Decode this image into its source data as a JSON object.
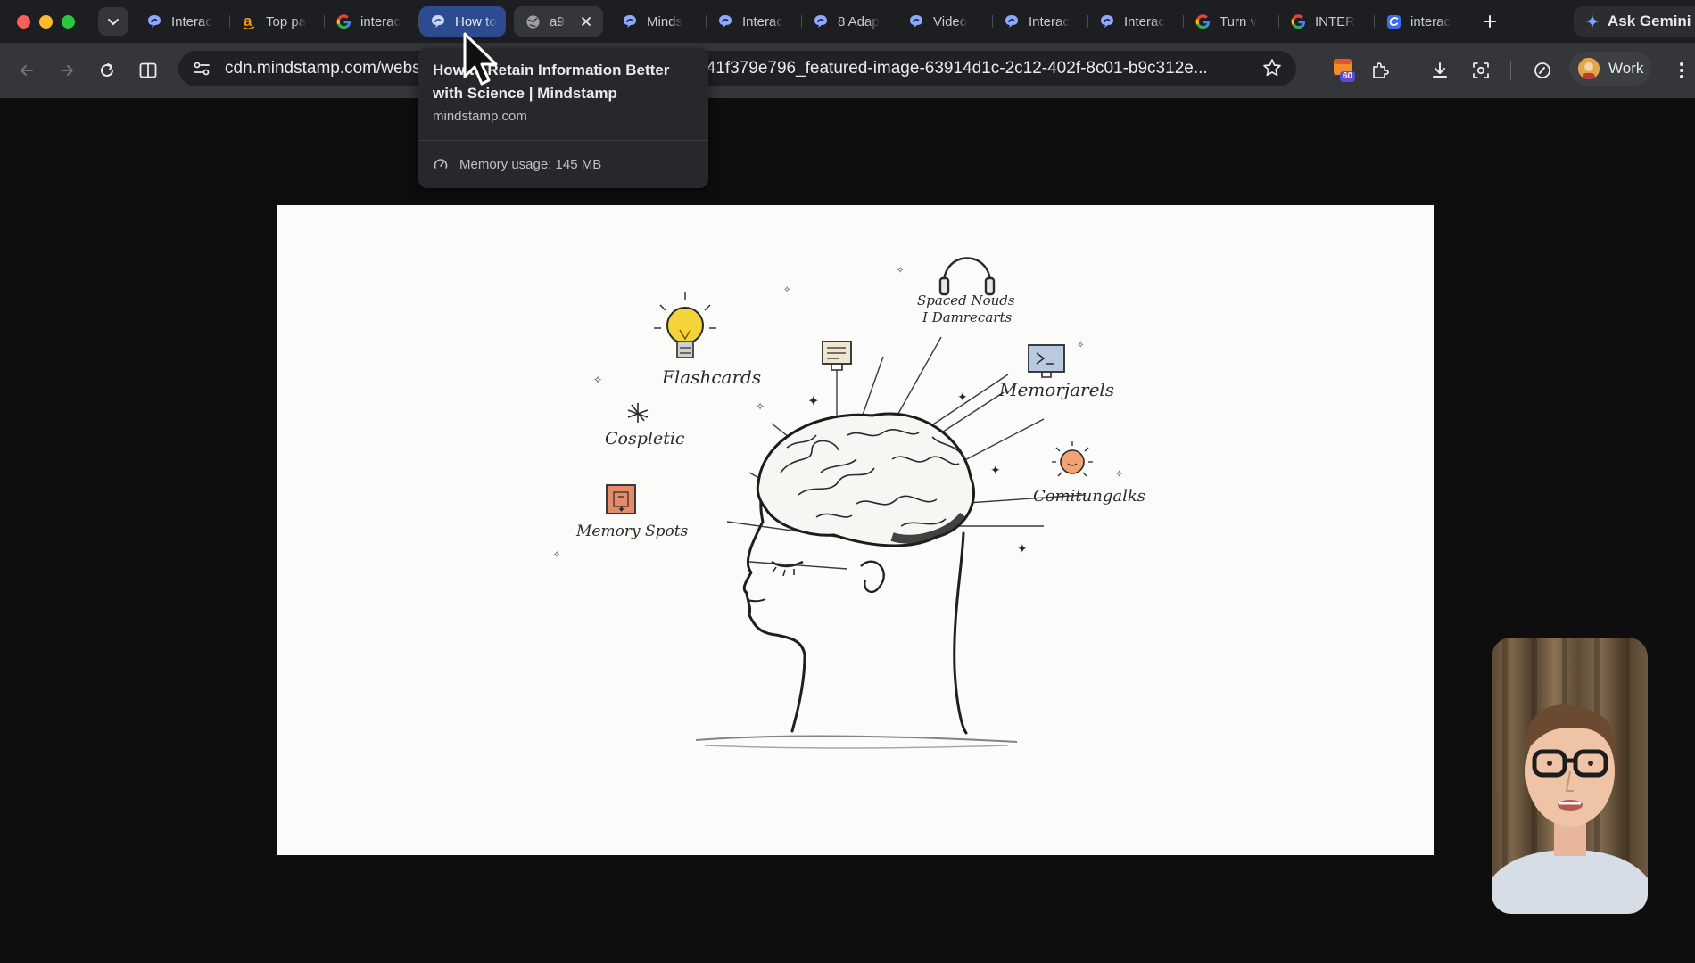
{
  "window": {
    "traffic_lights": [
      "close",
      "minimize",
      "maximize"
    ]
  },
  "tabs": [
    {
      "title": "Interac",
      "favicon": "mindstamp-icon"
    },
    {
      "title": "Top pa",
      "favicon": "amazon-icon"
    },
    {
      "title": "interac",
      "favicon": "google-icon"
    },
    {
      "title": "How to",
      "favicon": "mindstamp-icon",
      "state": "hover"
    },
    {
      "title": "a9",
      "favicon": "globe-icon",
      "state": "active"
    },
    {
      "title": "Minds",
      "favicon": "mindstamp-icon"
    },
    {
      "title": "Interac",
      "favicon": "mindstamp-icon"
    },
    {
      "title": "8 Adap",
      "favicon": "mindstamp-icon"
    },
    {
      "title": "Video",
      "favicon": "mindstamp-icon"
    },
    {
      "title": "Interac",
      "favicon": "mindstamp-icon"
    },
    {
      "title": "Interac",
      "favicon": "mindstamp-icon"
    },
    {
      "title": "Turn v",
      "favicon": "google-icon"
    },
    {
      "title": "INTER",
      "favicon": "google-icon"
    },
    {
      "title": "interac",
      "favicon": "cursive-c-icon"
    }
  ],
  "gemini": {
    "label": "Ask Gemini"
  },
  "toolbar": {
    "url": "cdn.mindstamp.com/website/images/06ca0c6d-8e04-47d2-2ebb41f379e796_featured-image-63914d1c-2c12-402f-8c01-b9c312e...",
    "extension_badge": "60",
    "profile_label": "Work"
  },
  "hovercard": {
    "title": "How to Retain Information Better with Science | Mindstamp",
    "domain": "mindstamp.com",
    "memory": "Memory usage: 145 MB"
  },
  "illustration": {
    "labels": {
      "flashcards": "Flashcards",
      "top": "Spaced Nouds",
      "top2": "I Damrecarts",
      "memorjarels": "Memorjarels",
      "cospletic": "Cospletic",
      "memory_spots": "Memory Spots",
      "comitungalks": "Comitungalks"
    }
  },
  "colors": {
    "tab_hover": "#2d4c8f",
    "tabstrip": "#1d1e22",
    "toolbar": "#35363a",
    "content_bg": "#0e0e0e"
  }
}
